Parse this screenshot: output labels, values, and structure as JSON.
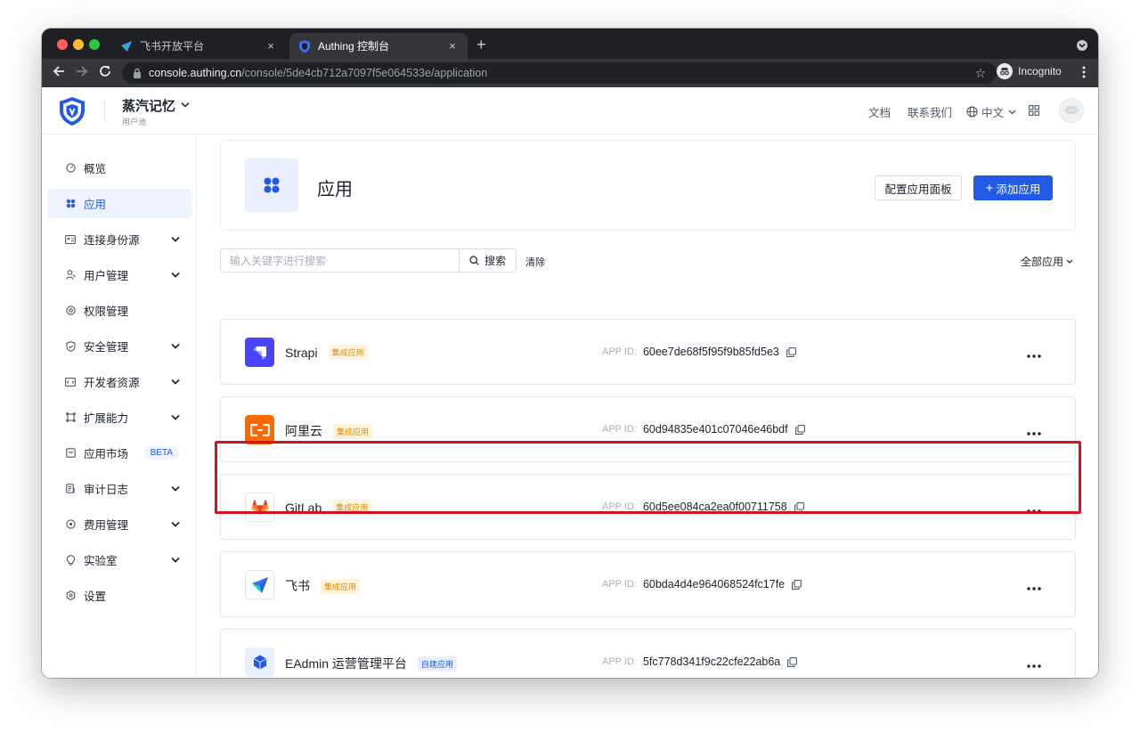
{
  "browser": {
    "tabs": [
      {
        "title": "飞书开放平台",
        "active": false
      },
      {
        "title": "Authing 控制台",
        "active": true
      }
    ],
    "url_host": "console.authing.cn",
    "url_path": "/console/5de4cb712a7097f5e064533e/application",
    "incognito_label": "Incognito",
    "new_tab_symbol": "+",
    "close_symbol": "×"
  },
  "header": {
    "pool_name": "蒸汽记忆",
    "pool_subtitle": "用户池",
    "nav": {
      "docs": "文档",
      "contact": "联系我们",
      "language": "中文"
    }
  },
  "sidebar": {
    "items": [
      {
        "label": "概览",
        "icon": "dashboard-icon",
        "expandable": false
      },
      {
        "label": "应用",
        "icon": "apps-icon",
        "expandable": false,
        "active": true
      },
      {
        "label": "连接身份源",
        "icon": "id-card-icon",
        "expandable": true
      },
      {
        "label": "用户管理",
        "icon": "user-icon",
        "expandable": true
      },
      {
        "label": "权限管理",
        "icon": "permission-icon",
        "expandable": false
      },
      {
        "label": "安全管理",
        "icon": "shield-icon",
        "expandable": true
      },
      {
        "label": "开发者资源",
        "icon": "code-icon",
        "expandable": true
      },
      {
        "label": "扩展能力",
        "icon": "extension-icon",
        "expandable": true
      },
      {
        "label": "应用市场",
        "icon": "market-icon",
        "expandable": false,
        "badge": "BETA"
      },
      {
        "label": "审计日志",
        "icon": "log-icon",
        "expandable": true
      },
      {
        "label": "费用管理",
        "icon": "billing-icon",
        "expandable": true
      },
      {
        "label": "实验室",
        "icon": "lab-icon",
        "expandable": true
      },
      {
        "label": "设置",
        "icon": "settings-icon",
        "expandable": false
      }
    ]
  },
  "main": {
    "title": "应用",
    "config_panel_button": "配置应用面板",
    "add_app_button": "添加应用",
    "search": {
      "placeholder": "输入关键字进行搜索",
      "value": "",
      "button": "搜索"
    },
    "clear_label": "清除",
    "filter_label": "全部应用",
    "appid_label": "APP ID:",
    "apps": [
      {
        "name": "Strapi",
        "tag": "集成应用",
        "tag_type": "integrated",
        "app_id": "60ee7de68f5f95f9b85fd5e3",
        "logo": "strapi-logo-icon",
        "color": "#4945ff"
      },
      {
        "name": "阿里云",
        "tag": "集成应用",
        "tag_type": "integrated",
        "app_id": "60d94835e401c07046e46bdf",
        "logo": "aliyun-logo-icon",
        "color": "#ff6a00"
      },
      {
        "name": "GitLab",
        "tag": "集成应用",
        "tag_type": "integrated",
        "app_id": "60d5ee084ca2ea0f00711758",
        "logo": "gitlab-logo-icon",
        "color": "#e24329",
        "highlighted": true
      },
      {
        "name": "飞书",
        "tag": "集成应用",
        "tag_type": "integrated",
        "app_id": "60bda4d4e964068524fc17fe",
        "logo": "feishu-logo-icon",
        "color": "#00d6b9"
      },
      {
        "name": "EAdmin 运营管理平台",
        "tag": "自建应用",
        "tag_type": "self",
        "app_id": "5fc778d341f9c22cfe22ab6a",
        "logo": "cube-logo-icon",
        "color": "#215ae5"
      }
    ]
  },
  "colors": {
    "accent": "#215ae5",
    "highlight_border": "#d0131e"
  }
}
